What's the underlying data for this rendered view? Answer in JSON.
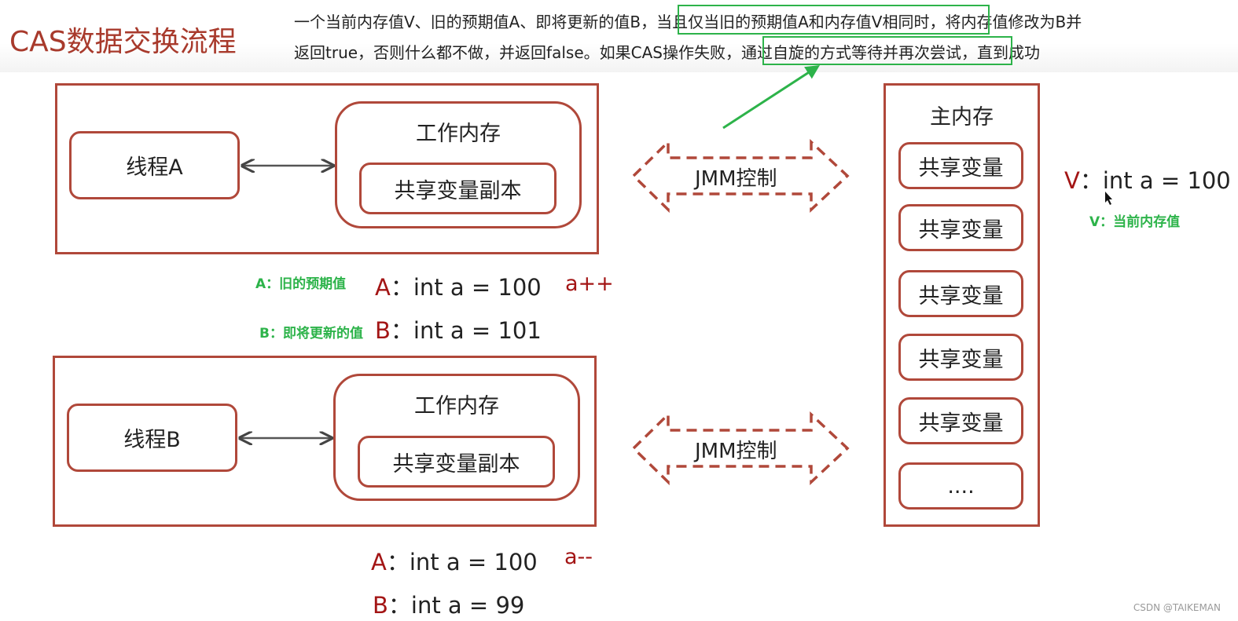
{
  "title": "CAS数据交换流程",
  "description": {
    "line1_pre": "一个当前内存值V、旧的预期值A、即将更新的值B，",
    "line1_highlight": "当且仅当旧的预期值A和内存值V相同时，",
    "line1_post": "将内存值修改为B并",
    "line2_pre": "返回true，否则什么都不做，并返回false。如果CAS操作失败，",
    "line2_highlight": "通过自旋的方式等待并再次尝试，",
    "line2_post": "直到成功"
  },
  "thread_a": {
    "thread_label": "线程A",
    "work_memory_label": "工作内存",
    "copy_label": "共享变量副本"
  },
  "thread_b": {
    "thread_label": "线程B",
    "work_memory_label": "工作内存",
    "copy_label": "共享变量副本"
  },
  "jmm_labels": [
    "JMM控制",
    "JMM控制"
  ],
  "main_memory": {
    "title": "主内存",
    "items": [
      "共享变量",
      "共享变量",
      "共享变量",
      "共享变量",
      "共享变量",
      "...."
    ]
  },
  "thread_a_values": {
    "note_a": "A：旧的预期值",
    "note_b": "B：即将更新的值",
    "a_key": "A",
    "a_expr": "：int a = 100",
    "b_key": "B",
    "b_expr": "：int a = 101",
    "op": "a++"
  },
  "thread_b_values": {
    "a_key": "A",
    "a_expr": "：int a = 100",
    "b_key": "B",
    "b_expr": "：int a = 99",
    "op": "a--"
  },
  "memory_value": {
    "v_key": "V",
    "v_expr": "：int a = 100",
    "note": "V：当前内存值"
  },
  "credit": "CSDN @TAIKEMAN",
  "colors": {
    "accent_red": "#a83a2c",
    "box_border": "#b0483a",
    "highlight_green": "#2db34a"
  }
}
